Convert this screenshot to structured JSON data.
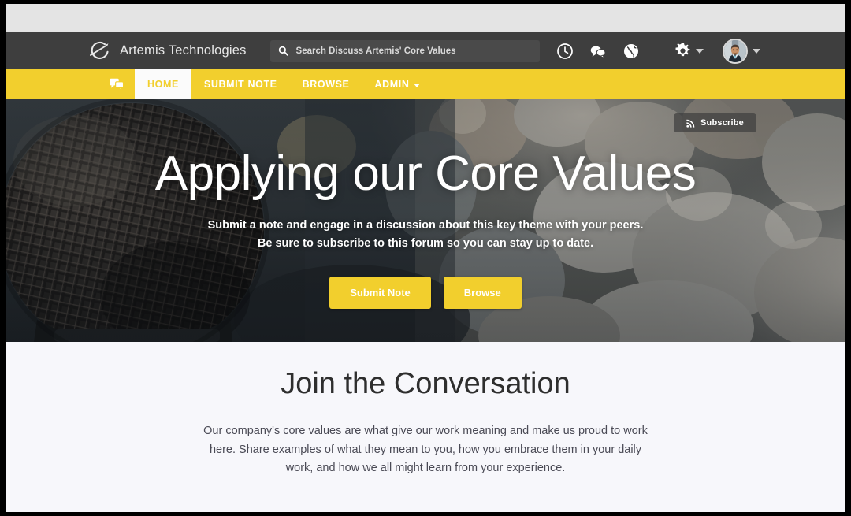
{
  "header": {
    "brand_name": "Artemis Technologies",
    "logo_icon": "artemis-bow-arrow-icon",
    "search": {
      "placeholder": "Search Discuss Artemis' Core Values",
      "value": "",
      "icon": "search-icon"
    },
    "icons": [
      {
        "name": "recent-activity-icon",
        "glyph": "clock"
      },
      {
        "name": "messages-icon",
        "glyph": "chat-bubbles"
      },
      {
        "name": "global-notifications-icon",
        "glyph": "globe"
      }
    ],
    "settings_icon": "gear-icon",
    "user_menu_icon": "avatar"
  },
  "nav": {
    "icon_item": {
      "name": "discussions-icon",
      "label": ""
    },
    "items": [
      {
        "label": "HOME",
        "active": true,
        "has_caret": false
      },
      {
        "label": "SUBMIT NOTE",
        "active": false,
        "has_caret": false
      },
      {
        "label": "BROWSE",
        "active": false,
        "has_caret": false
      },
      {
        "label": "ADMIN",
        "active": false,
        "has_caret": true
      }
    ]
  },
  "hero": {
    "subscribe_label": "Subscribe",
    "subscribe_icon": "rss-icon",
    "title": "Applying our Core Values",
    "subtitle": "Submit a note and engage in a discussion about this key theme with your peers. Be sure to subscribe to this forum so you can stay up to date.",
    "primary_button": "Submit Note",
    "secondary_button": "Browse",
    "background_description": "close-up of a black microphone head with a blurred audience behind it"
  },
  "section": {
    "title": "Join the Conversation",
    "body": "Our company's core values are what give our work meaning and make us proud to work here. Share examples of what they mean to you, how you embrace them in your daily work, and how we all might learn from your experience."
  },
  "colors": {
    "accent_yellow": "#f2cf2d",
    "header_dark": "#3e3e3e",
    "browser_bar": "#e4e4e4",
    "section_bg": "#f7f7fb",
    "nav_active_bg": "#fbfbfb"
  }
}
